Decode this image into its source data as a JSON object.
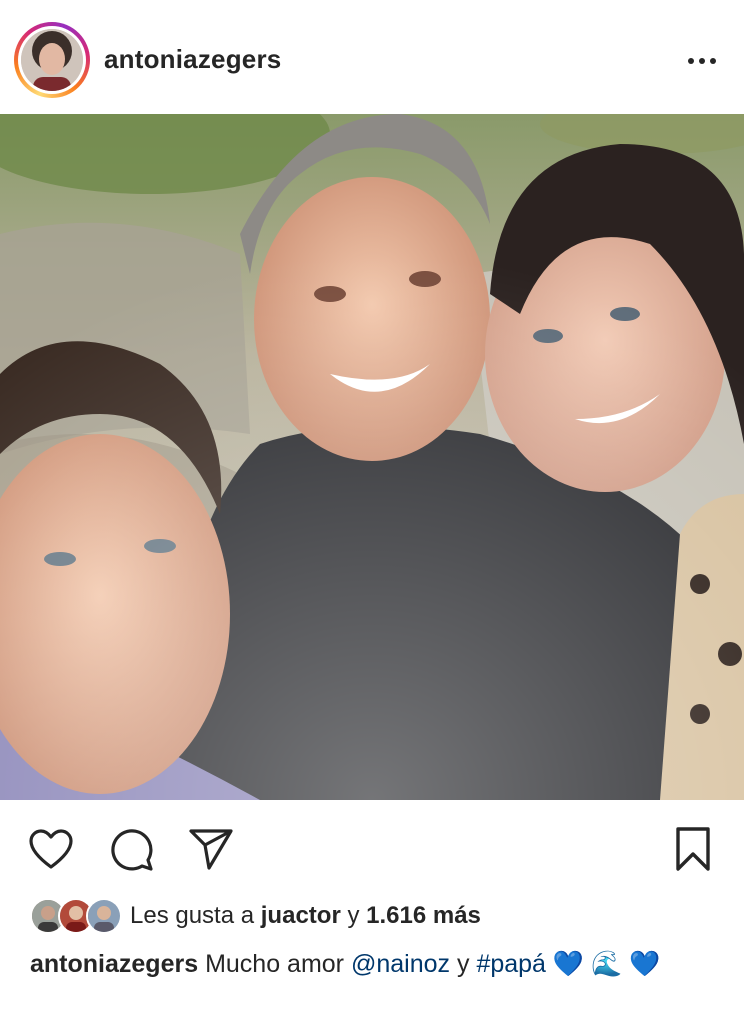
{
  "post": {
    "username": "antoniazegers",
    "photo_description_icon": "photo",
    "likes": {
      "prefix": "Les gusta a",
      "user": "juactor",
      "connector": "y",
      "count": "1.616 más"
    },
    "caption": {
      "user": "antoniazegers",
      "text_before": "Mucho amor",
      "mention": "@nainoz",
      "connector": "y",
      "hashtag": "#papá",
      "emoji1": "💙",
      "emoji2": "🌊",
      "emoji3": "💙"
    }
  },
  "icons": {
    "more": "more-options-icon",
    "like": "heart-icon",
    "comment": "comment-icon",
    "share": "send-icon",
    "save": "bookmark-icon"
  },
  "colors": {
    "text": "#262626",
    "link": "#00376b",
    "heart_emoji": "#1f7ae0"
  }
}
